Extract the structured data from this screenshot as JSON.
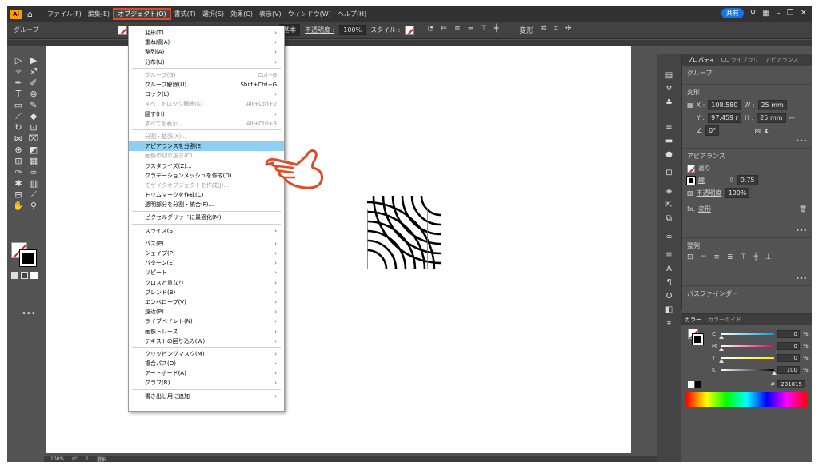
{
  "menubar": {
    "logo": "Ai",
    "items": [
      "ファイル(F)",
      "編集(E)",
      "オブジェクト(O)",
      "書式(T)",
      "選択(S)",
      "効果(C)",
      "表示(V)",
      "ウィンドウ(W)",
      "ヘルプ(H)"
    ],
    "active_index": 2,
    "share_label": "共有"
  },
  "controlbar": {
    "selection_label": "グループ",
    "stroke_style": "基本",
    "opacity_label": "不透明度 :",
    "opacity_value": "100%",
    "style_label": "スタイル :",
    "transform_label": "変形"
  },
  "dropdown": {
    "items": [
      {
        "label": "変形(T)",
        "shortcut": "",
        "submenu": true,
        "disabled": false
      },
      {
        "label": "重ね順(A)",
        "shortcut": "",
        "submenu": true,
        "disabled": false
      },
      {
        "label": "整列(A)",
        "shortcut": "",
        "submenu": true,
        "disabled": false
      },
      {
        "label": "分布(U)",
        "shortcut": "",
        "submenu": true,
        "disabled": false
      },
      {
        "sep": true
      },
      {
        "label": "グループ(G)",
        "shortcut": "Ctrl+G",
        "submenu": false,
        "disabled": true
      },
      {
        "label": "グループ解除(U)",
        "shortcut": "Shift+Ctrl+G",
        "submenu": false,
        "disabled": false
      },
      {
        "label": "ロック(L)",
        "shortcut": "",
        "submenu": true,
        "disabled": false
      },
      {
        "label": "すべてをロック解除(K)",
        "shortcut": "Alt+Ctrl+2",
        "submenu": false,
        "disabled": true
      },
      {
        "label": "隠す(H)",
        "shortcut": "",
        "submenu": true,
        "disabled": false
      },
      {
        "label": "すべてを表示",
        "shortcut": "Alt+Ctrl+3",
        "submenu": false,
        "disabled": true
      },
      {
        "sep": true
      },
      {
        "label": "分割・拡張(X)...",
        "shortcut": "",
        "submenu": false,
        "disabled": true
      },
      {
        "label": "アピアランスを分割(E)",
        "shortcut": "",
        "submenu": false,
        "disabled": false,
        "highlight": true
      },
      {
        "label": "画像の切り抜き(C)",
        "shortcut": "",
        "submenu": false,
        "disabled": true
      },
      {
        "label": "ラスタライズ(Z)...",
        "shortcut": "",
        "submenu": false,
        "disabled": false
      },
      {
        "label": "グラデーションメッシュを作成(D)...",
        "shortcut": "",
        "submenu": false,
        "disabled": false
      },
      {
        "label": "モザイクオブジェクトを作成(J)...",
        "shortcut": "",
        "submenu": false,
        "disabled": true
      },
      {
        "label": "トリムマークを作成(C)",
        "shortcut": "",
        "submenu": false,
        "disabled": false
      },
      {
        "label": "透明部分を分割・統合(F)...",
        "shortcut": "",
        "submenu": false,
        "disabled": false
      },
      {
        "sep": true
      },
      {
        "label": "ピクセルグリッドに最適化(M)",
        "shortcut": "",
        "submenu": false,
        "disabled": false
      },
      {
        "sep": true
      },
      {
        "label": "スライス(S)",
        "shortcut": "",
        "submenu": true,
        "disabled": false
      },
      {
        "sep": true
      },
      {
        "label": "パス(P)",
        "shortcut": "",
        "submenu": true,
        "disabled": false
      },
      {
        "label": "シェイプ(P)",
        "shortcut": "",
        "submenu": true,
        "disabled": false
      },
      {
        "label": "パターン(E)",
        "shortcut": "",
        "submenu": true,
        "disabled": false
      },
      {
        "label": "リピート",
        "shortcut": "",
        "submenu": true,
        "disabled": false
      },
      {
        "label": "クロスと重なり",
        "shortcut": "",
        "submenu": true,
        "disabled": false
      },
      {
        "label": "ブレンド(B)",
        "shortcut": "",
        "submenu": true,
        "disabled": false
      },
      {
        "label": "エンベロープ(V)",
        "shortcut": "",
        "submenu": true,
        "disabled": false
      },
      {
        "label": "遠近(P)",
        "shortcut": "",
        "submenu": true,
        "disabled": false
      },
      {
        "label": "ライブペイント(N)",
        "shortcut": "",
        "submenu": true,
        "disabled": false
      },
      {
        "label": "画像トレース",
        "shortcut": "",
        "submenu": true,
        "disabled": false
      },
      {
        "label": "テキストの回り込み(W)",
        "shortcut": "",
        "submenu": true,
        "disabled": false
      },
      {
        "sep": true
      },
      {
        "label": "クリッピングマスク(M)",
        "shortcut": "",
        "submenu": true,
        "disabled": false
      },
      {
        "label": "複合パス(O)",
        "shortcut": "",
        "submenu": true,
        "disabled": false
      },
      {
        "label": "アートボード(A)",
        "shortcut": "",
        "submenu": true,
        "disabled": false
      },
      {
        "label": "グラフ(R)",
        "shortcut": "",
        "submenu": true,
        "disabled": false
      },
      {
        "sep": true
      },
      {
        "label": "書き出し用に追加",
        "shortcut": "",
        "submenu": true,
        "disabled": false
      }
    ]
  },
  "properties": {
    "tabs": [
      "プロパティ",
      "CC ライブラリ",
      "アピアランス"
    ],
    "active_tab": 0,
    "selection": "グループ",
    "transform": {
      "title": "変形",
      "x_label": "X :",
      "x_value": "108.580",
      "y_label": "Y :",
      "y_value": "97.459 r",
      "w_label": "W :",
      "w_value": "25 mm",
      "h_label": "H :",
      "h_value": "25 mm",
      "angle": "0°"
    },
    "appearance": {
      "title": "アピアランス",
      "fill_label": "塗り",
      "stroke_label": "線",
      "stroke_value": "0.75",
      "opacity_label": "不透明度",
      "opacity_value": "100%",
      "fx_label": "fx.",
      "fx_value": "変形"
    },
    "align_title": "整列",
    "pathfinder_title": "パスファインダー"
  },
  "color_panel": {
    "tabs": [
      "カラー",
      "カラーガイド"
    ],
    "active_tab": 0,
    "channels": [
      {
        "name": "C",
        "value": "0",
        "fraction": 0
      },
      {
        "name": "M",
        "value": "0",
        "fraction": 0
      },
      {
        "name": "Y",
        "value": "0",
        "fraction": 0
      },
      {
        "name": "K",
        "value": "100",
        "fraction": 1
      }
    ],
    "percent": "%",
    "hex_symbol": "#",
    "hex": "231815"
  },
  "statusbar": {
    "zoom": "100%",
    "rotation": "0°",
    "artboard": "1",
    "tool": "選択"
  },
  "colors": {
    "accent_red": "#e24a26",
    "highlight_blue": "#8fcff2",
    "share_blue": "#1473e6",
    "ui_dark": "#535353"
  }
}
